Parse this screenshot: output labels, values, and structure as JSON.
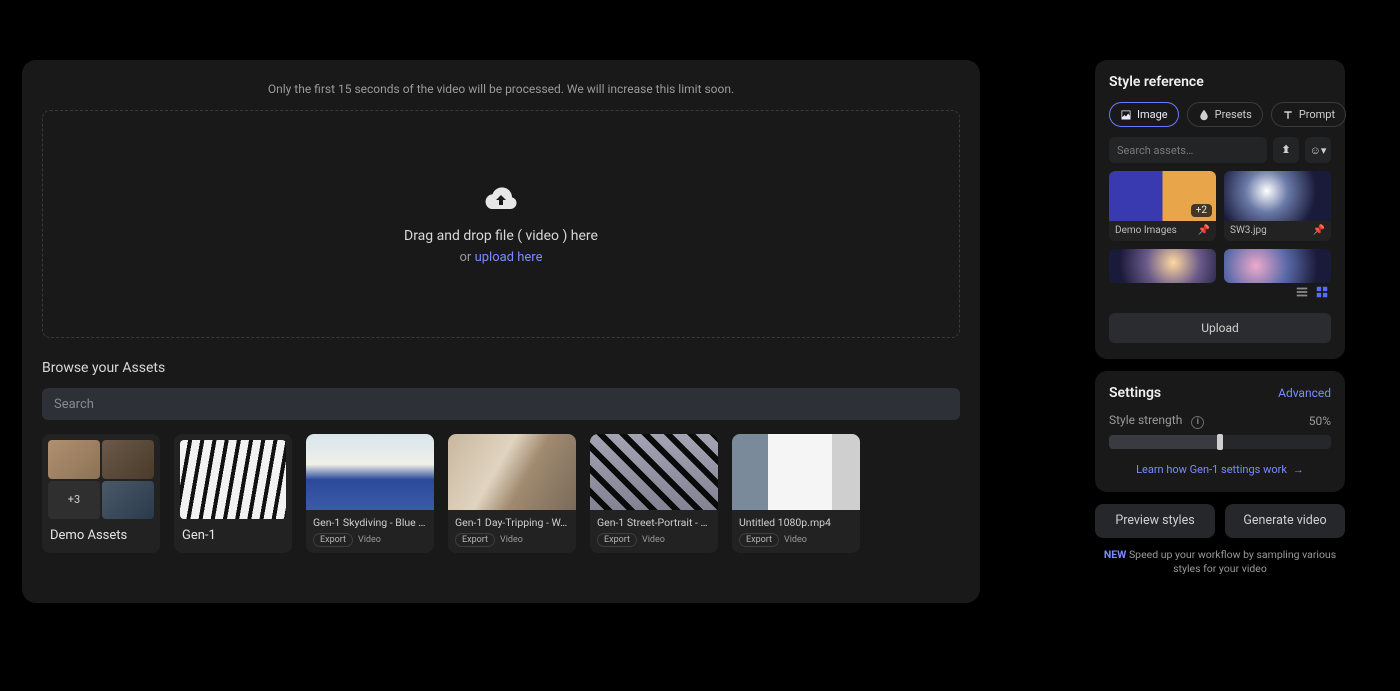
{
  "main": {
    "notice": "Only the first 15 seconds of the video will be processed. We will increase this limit soon.",
    "dropzone": {
      "title": "Drag and drop file ( video ) here",
      "or": "or ",
      "upload_link": "upload here"
    },
    "browse_label": "Browse your Assets",
    "search_placeholder": "Search",
    "folders": [
      {
        "name": "Demo Assets",
        "extra_badge": "+3"
      },
      {
        "name": "Gen-1"
      }
    ],
    "assets": [
      {
        "title": "Gen-1 Skydiving - Blue …",
        "tag1": "Export",
        "tag2": "Video"
      },
      {
        "title": "Gen-1 Day-Tripping - W…",
        "tag1": "Export",
        "tag2": "Video"
      },
      {
        "title": "Gen-1 Street-Portrait - …",
        "tag1": "Export",
        "tag2": "Video"
      },
      {
        "title": "Untitled 1080p.mp4",
        "tag1": "Export",
        "tag2": "Video"
      }
    ]
  },
  "style_ref": {
    "title": "Style reference",
    "tabs": {
      "image": "Image",
      "presets": "Presets",
      "prompt": "Prompt"
    },
    "search_placeholder": "Search assets…",
    "cards": [
      {
        "name": "Demo Images",
        "extra": "+2"
      },
      {
        "name": "SW3.jpg"
      }
    ],
    "upload_label": "Upload"
  },
  "settings": {
    "title": "Settings",
    "advanced": "Advanced",
    "strength_label": "Style strength",
    "strength_value": "50%",
    "strength_pct": 50,
    "learn_link": "Learn how Gen-1 settings work"
  },
  "actions": {
    "preview": "Preview styles",
    "generate": "Generate video",
    "tip_prefix": "NEW",
    "tip": " Speed up your workflow by sampling various styles for your video"
  },
  "colors": {
    "accent": "#7b8cff"
  }
}
